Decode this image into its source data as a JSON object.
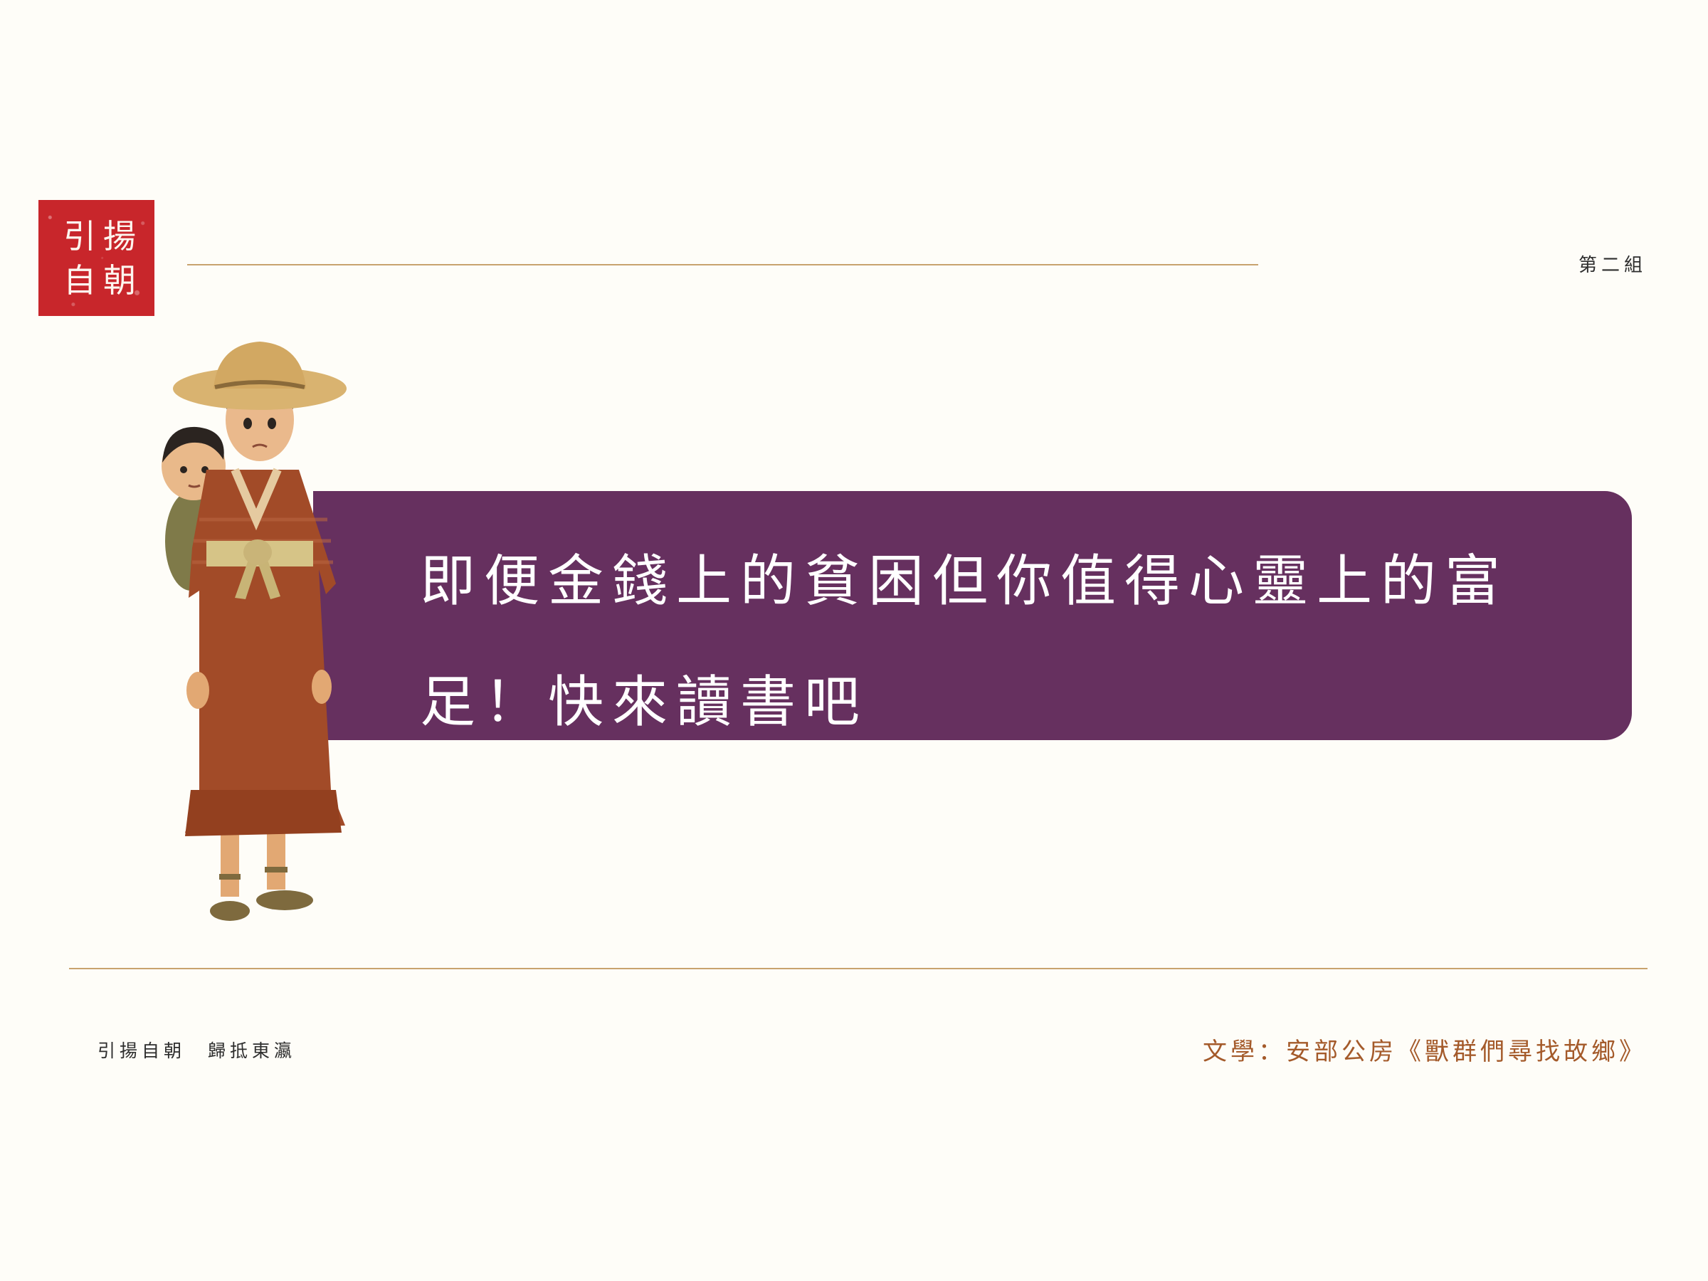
{
  "seal": {
    "chars": [
      "引",
      "揚",
      "自",
      "朝"
    ]
  },
  "header": {
    "group": "第二組"
  },
  "banner": {
    "text": "即便金錢上的貧困但你值得心靈上的富足！快來讀書吧"
  },
  "illustration": {
    "subject": "mother-carrying-child-illustration"
  },
  "footer": {
    "left": "引揚自朝　歸抵東瀛",
    "right": "文學：安部公房《獸群們尋找故鄉》"
  },
  "colors": {
    "background": "#fefdf8",
    "seal": "#c8262b",
    "banner": "#66305f",
    "rule": "#c8a36e",
    "footer_right": "#a45a2a"
  }
}
